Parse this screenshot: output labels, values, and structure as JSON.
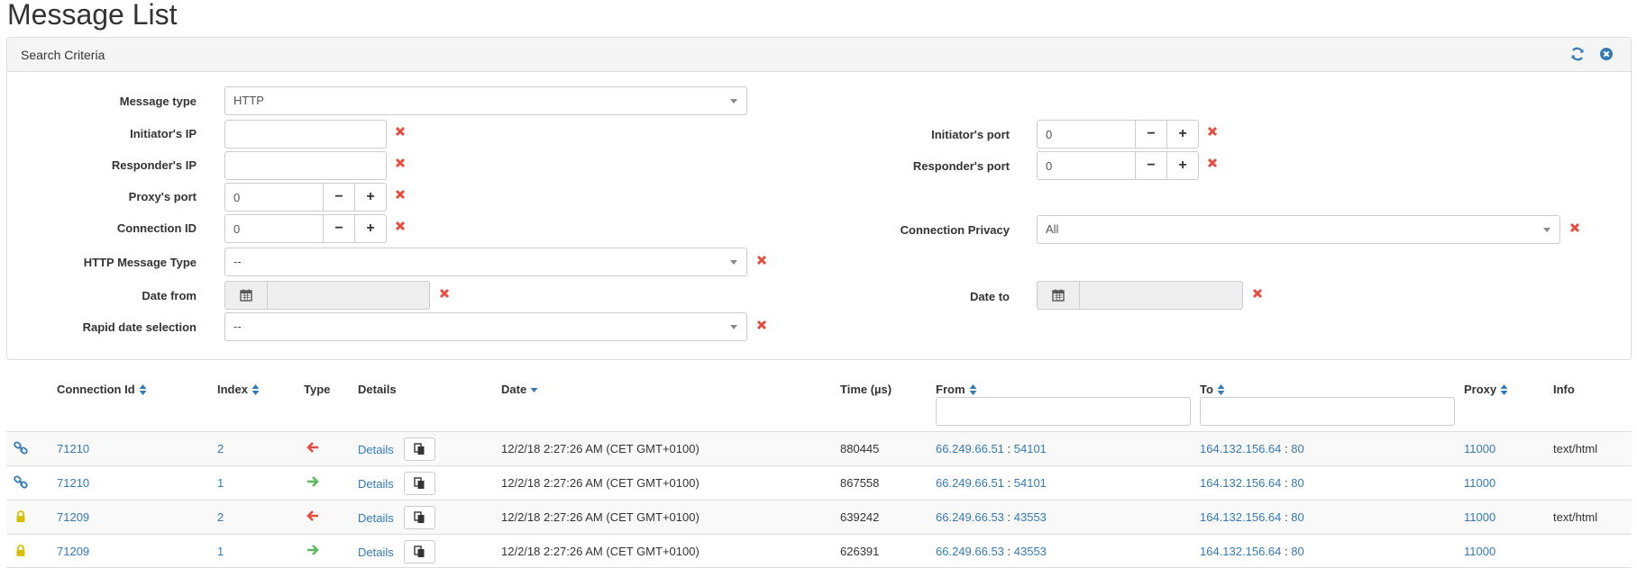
{
  "page": {
    "title": "Message List"
  },
  "panel": {
    "title": "Search Criteria",
    "tools": {
      "refresh_icon": "refresh-icon",
      "close_icon": "close-circle-icon"
    }
  },
  "form": {
    "message_type": {
      "label": "Message type",
      "value": "HTTP"
    },
    "initiator_ip": {
      "label": "Initiator's IP",
      "value": ""
    },
    "responder_ip": {
      "label": "Responder's IP",
      "value": ""
    },
    "proxy_port": {
      "label": "Proxy's port",
      "value": "0"
    },
    "connection_id": {
      "label": "Connection ID",
      "value": "0"
    },
    "http_message_type": {
      "label": "HTTP Message Type",
      "value": "--"
    },
    "date_from": {
      "label": "Date from",
      "value": ""
    },
    "rapid_date": {
      "label": "Rapid date selection",
      "value": "--"
    },
    "initiator_port": {
      "label": "Initiator's port",
      "value": "0"
    },
    "responder_port": {
      "label": "Responder's port",
      "value": "0"
    },
    "connection_privacy": {
      "label": "Connection Privacy",
      "value": "All"
    },
    "date_to": {
      "label": "Date to",
      "value": ""
    },
    "minus_glyph": "−",
    "plus_glyph": "+"
  },
  "table": {
    "headers": {
      "connection_id": "Connection Id",
      "index": "Index",
      "type": "Type",
      "details": "Details",
      "date": "Date",
      "time": "Time (µs)",
      "from": "From",
      "to": "To",
      "proxy": "Proxy",
      "info": "Info"
    },
    "rows": [
      {
        "icon": "link-icon",
        "connection_id": "71210",
        "index": "2",
        "direction": "arrow-left-icon",
        "details": "Details",
        "date": "12/2/18 2:27:26 AM (CET GMT+0100)",
        "time": "880445",
        "from_ip": "66.249.66.51",
        "from_port": "54101",
        "to_ip": "164.132.156.64",
        "to_port": "80",
        "proxy": "11000",
        "info": "text/html"
      },
      {
        "icon": "link-icon",
        "connection_id": "71210",
        "index": "1",
        "direction": "arrow-right-icon",
        "details": "Details",
        "date": "12/2/18 2:27:26 AM (CET GMT+0100)",
        "time": "867558",
        "from_ip": "66.249.66.51",
        "from_port": "54101",
        "to_ip": "164.132.156.64",
        "to_port": "80",
        "proxy": "11000",
        "info": ""
      },
      {
        "icon": "lock-icon",
        "connection_id": "71209",
        "index": "2",
        "direction": "arrow-left-icon",
        "details": "Details",
        "date": "12/2/18 2:27:26 AM (CET GMT+0100)",
        "time": "639242",
        "from_ip": "66.249.66.53",
        "from_port": "43553",
        "to_ip": "164.132.156.64",
        "to_port": "80",
        "proxy": "11000",
        "info": "text/html"
      },
      {
        "icon": "lock-icon",
        "connection_id": "71209",
        "index": "1",
        "direction": "arrow-right-icon",
        "details": "Details",
        "date": "12/2/18 2:27:26 AM (CET GMT+0100)",
        "time": "626391",
        "from_ip": "66.249.66.53",
        "from_port": "43553",
        "to_ip": "164.132.156.64",
        "to_port": "80",
        "proxy": "11000",
        "info": ""
      }
    ],
    "port_separator": " : "
  },
  "colors": {
    "link": "#337ab7",
    "clear": "#e74c3c",
    "arrow_in": "#e74c3c",
    "arrow_out": "#5cb85c",
    "lock": "#d6c000"
  }
}
